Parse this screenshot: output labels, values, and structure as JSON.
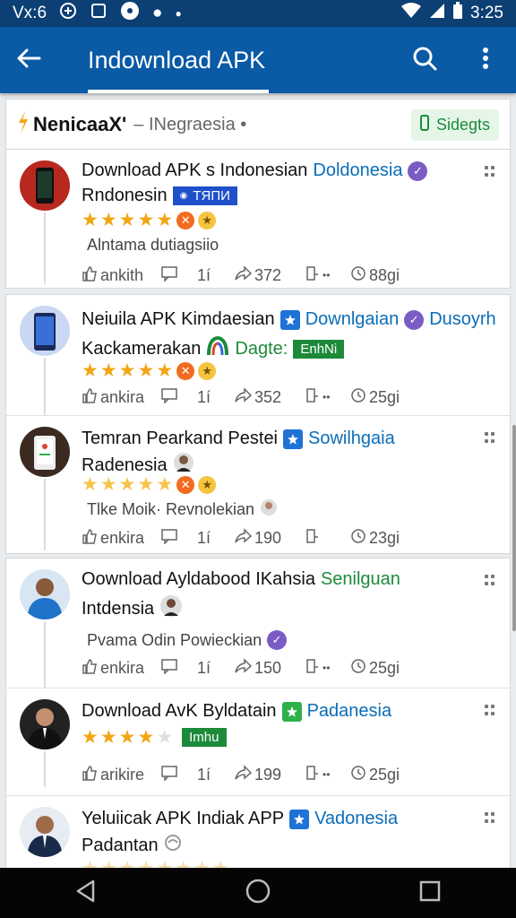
{
  "status_bar": {
    "left_text": "Vx:6",
    "time": "3:25"
  },
  "app_bar": {
    "title": "Indownload APK",
    "icons": {
      "back": "arrow-back-icon",
      "search": "search-icon",
      "more": "more-vert-icon"
    }
  },
  "source": {
    "brand": "NenicaaX'",
    "subtitle": "– INegraesia •",
    "chip": "Sidegts"
  },
  "posts": [
    {
      "title_a": "Download APK s  Indonesian",
      "tag": "Doldonesia",
      "line2": "Rndonesin",
      "pill": "TЯПИ",
      "rating": 5,
      "subtext": "Alntama dutiagsiio",
      "actions": {
        "like": "ankith",
        "comments": "1í",
        "shares": "372",
        "time": "88gi"
      }
    },
    {
      "title_a": "Neiuila APK Kimdaesian",
      "tag": "Downlgaian",
      "tag2": "Dusoyrh",
      "line2": "Kackamerakan",
      "tag3": "Dagte:",
      "pill": "EnhNi",
      "rating": 5,
      "actions": {
        "like": "ankira",
        "comments": "1í",
        "shares": "352",
        "time": "25gi"
      }
    },
    {
      "title_a": "Temran Pearkand Pestei",
      "tag": "Sowilhgaia",
      "line2": "Radenesia",
      "rating": 5,
      "subtext": "Tlke Moik· Revnolekian",
      "actions": {
        "like": "enkira",
        "comments": "1í",
        "shares": "190",
        "time": "23gi"
      }
    },
    {
      "title_a": "Oownload Ayldabood IKahsia",
      "tag": "Senilguan",
      "line2": "Intdensia",
      "subtext": "Pvama Odin Powieckian",
      "actions": {
        "like": "enkira",
        "comments": "1í",
        "shares": "150",
        "time": "25gi"
      }
    },
    {
      "title_a": "Download AvK Byldatain",
      "tag": "Padanesia",
      "rating": 4,
      "pill": "Imhu",
      "actions": {
        "like": "arikire",
        "comments": "1í",
        "shares": "199",
        "time": "25gi"
      }
    },
    {
      "title_a": "Yeluiicak APK Indiak APP",
      "tag": "Vadonesia",
      "line2": "Padantan"
    }
  ],
  "nav": {
    "back": "nav-back-icon",
    "home": "nav-home-icon",
    "recents": "nav-recents-icon"
  }
}
